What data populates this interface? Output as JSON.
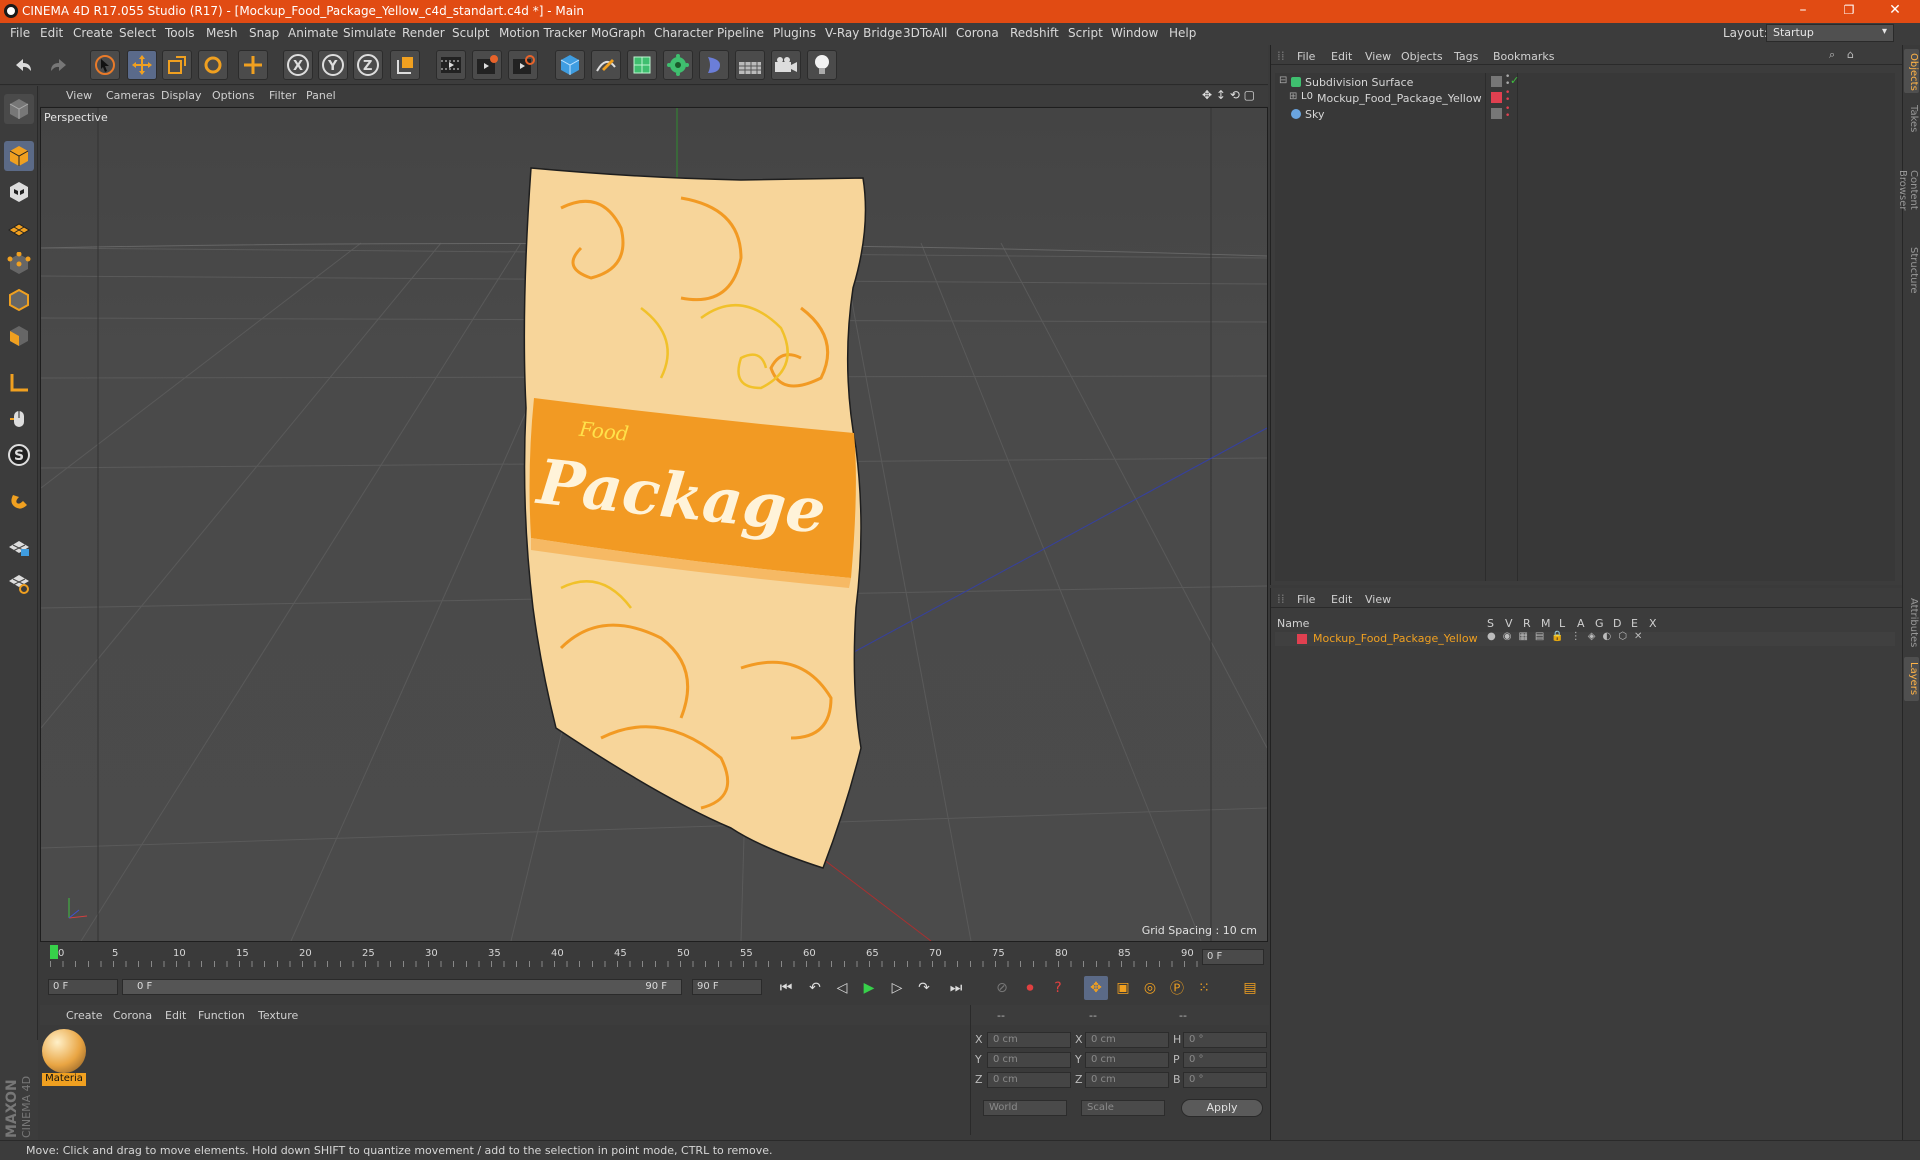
{
  "window": {
    "title": "CINEMA 4D R17.055 Studio (R17) - [Mockup_Food_Package_Yellow_c4d_standart.c4d *] - Main",
    "minimize": "–",
    "restore": "❐",
    "close": "✕"
  },
  "menubar": {
    "items": [
      "File",
      "Edit",
      "Create",
      "Select",
      "Tools",
      "Mesh",
      "Snap",
      "Animate",
      "Simulate",
      "Render",
      "Sculpt",
      "Motion Tracker",
      "MoGraph",
      "Character",
      "Pipeline",
      "Plugins",
      "V-Ray Bridge",
      "3DToAll",
      "Corona",
      "Redshift",
      "Script",
      "Window",
      "Help"
    ],
    "layout_label": "Layout:",
    "layout_value": "Startup"
  },
  "viewport": {
    "menu": [
      "View",
      "Cameras",
      "Display",
      "Options",
      "Filter",
      "Panel"
    ],
    "label": "Perspective",
    "grid_spacing": "Grid Spacing : 10 cm",
    "package_text": "Package",
    "package_subtext": "Food"
  },
  "timeline": {
    "ticks": [
      "0",
      "5",
      "10",
      "15",
      "20",
      "25",
      "30",
      "35",
      "40",
      "45",
      "50",
      "55",
      "60",
      "65",
      "70",
      "75",
      "80",
      "85",
      "90"
    ],
    "end_frame": "0 F"
  },
  "transport": {
    "start": "0 F",
    "slider_start": "0 F",
    "slider_end": "90 F",
    "end": "90 F"
  },
  "materials": {
    "menu": [
      "Create",
      "Corona",
      "Edit",
      "Function",
      "Texture"
    ],
    "items": [
      {
        "label": "Materia"
      }
    ]
  },
  "coords": {
    "headers": [
      "--",
      "--",
      "--"
    ],
    "rows": [
      {
        "a": "X",
        "av": "0 cm",
        "b": "X",
        "bv": "0 cm",
        "c": "H",
        "cv": "0 °"
      },
      {
        "a": "Y",
        "av": "0 cm",
        "b": "Y",
        "bv": "0 cm",
        "c": "P",
        "cv": "0 °"
      },
      {
        "a": "Z",
        "av": "0 cm",
        "b": "Z",
        "bv": "0 cm",
        "c": "B",
        "cv": "0 °"
      }
    ],
    "world": "World",
    "scale": "Scale",
    "apply": "Apply"
  },
  "objects": {
    "menu": [
      "File",
      "Edit",
      "View",
      "Objects",
      "Tags",
      "Bookmarks"
    ],
    "items": [
      {
        "name": "Subdivision Surface"
      },
      {
        "name": "Mockup_Food_Package_Yellow"
      },
      {
        "name": "Sky"
      }
    ]
  },
  "layers": {
    "menu": [
      "File",
      "Edit",
      "View"
    ],
    "columns": [
      "Name",
      "S",
      "V",
      "R",
      "M",
      "L",
      "A",
      "G",
      "D",
      "E",
      "X"
    ],
    "items": [
      {
        "name": "Mockup_Food_Package_Yellow"
      }
    ]
  },
  "right_tabs": [
    "Objects",
    "Takes",
    "Content Browser",
    "Structure",
    "Attributes",
    "Layers"
  ],
  "status": "Move: Click and drag to move elements. Hold down SHIFT to quantize movement / add to the selection in point mode, CTRL to remove.",
  "brand": {
    "maxon": "MAXON",
    "c4d": "CINEMA 4D"
  },
  "colors": {
    "titlebar": "#e14b13",
    "accent": "#f0a020",
    "layer": "#e04050"
  }
}
